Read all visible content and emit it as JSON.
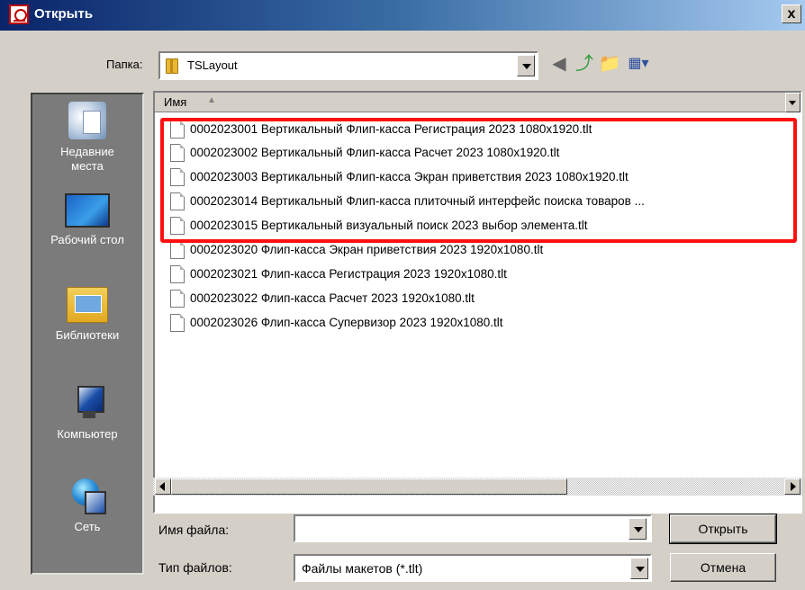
{
  "window": {
    "title": "Открыть",
    "close_label": "x"
  },
  "toolbar": {
    "folder_label": "Папка:",
    "folder_value": "TSLayout",
    "icons": [
      "back-icon",
      "up-folder-icon",
      "new-folder-icon",
      "views-menu-icon"
    ]
  },
  "places": [
    {
      "label_lines": [
        "Недавние",
        "места"
      ],
      "icon": "recent-places-icon"
    },
    {
      "label_lines": [
        "Рабочий стол"
      ],
      "icon": "desktop-icon"
    },
    {
      "label_lines": [
        "Библиотеки"
      ],
      "icon": "libraries-icon"
    },
    {
      "label_lines": [
        "Компьютер"
      ],
      "icon": "computer-icon"
    },
    {
      "label_lines": [
        "Сеть"
      ],
      "icon": "network-icon"
    }
  ],
  "filelist": {
    "column_name": "Имя",
    "files": [
      "0002023001 Вертикальный Флип-касса Регистрация 2023 1080x1920.tlt",
      "0002023002 Вертикальный Флип-касса Расчет 2023 1080x1920.tlt",
      "0002023003 Вертикальный Флип-касса Экран приветствия 2023 1080x1920.tlt",
      "0002023014 Вертикальный Флип-касса плиточный интерфейс поиска товаров ...",
      "0002023015 Вертикальный визуальный поиск 2023 выбор элемента.tlt",
      "0002023020 Флип-касса Экран приветствия 2023 1920x1080.tlt",
      "0002023021 Флип-касса Регистрация 2023 1920x1080.tlt",
      "0002023022 Флип-касса Расчет 2023 1920x1080.tlt",
      "0002023026 Флип-касса Супервизор 2023 1920x1080.tlt"
    ],
    "highlight_color": "#ff1010"
  },
  "form": {
    "filename_label": "Имя файла:",
    "filename_value": "",
    "filetype_label": "Тип файлов:",
    "filetype_value": "Файлы макетов (*.tlt)"
  },
  "buttons": {
    "open": "Открыть",
    "cancel": "Отмена"
  },
  "colors": {
    "title_bar": "#0a246a",
    "dialog_bg": "#d4d0c8",
    "places_bg": "#7b7b7b"
  }
}
